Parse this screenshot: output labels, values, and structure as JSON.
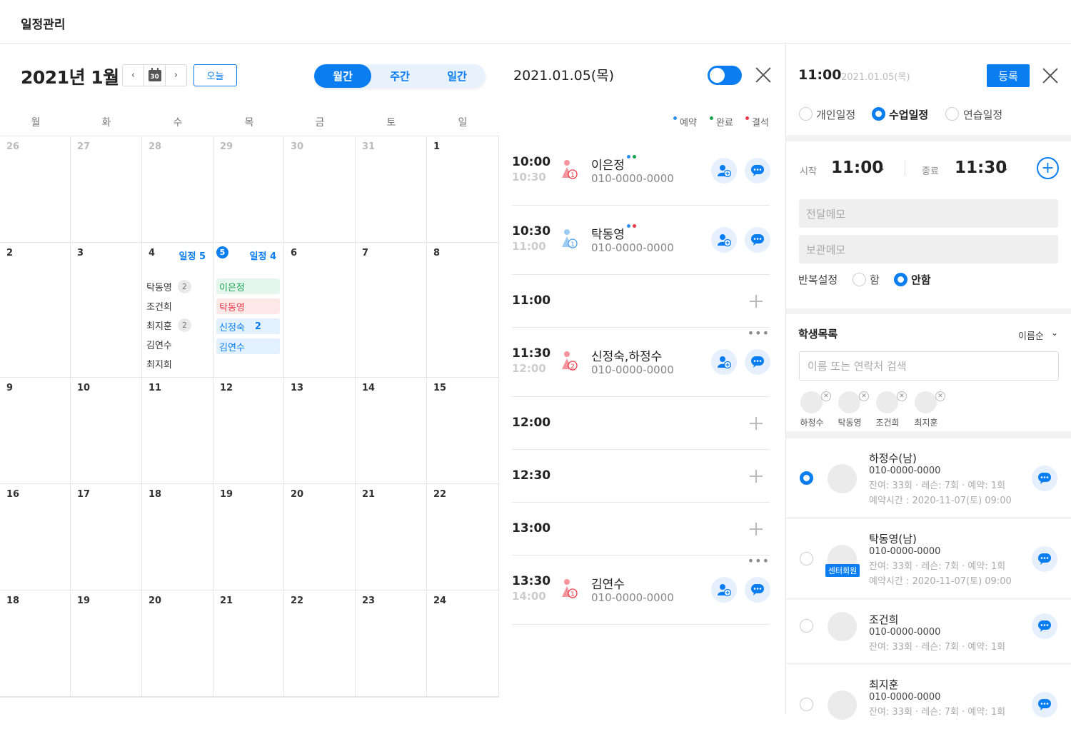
{
  "app": {
    "title": "일정관리"
  },
  "calendar": {
    "month_title": "2021년 1월",
    "calendar_icon_day": "30",
    "today_label": "오늘",
    "view_tabs": [
      "월간",
      "주간",
      "일간"
    ],
    "active_view": "월간",
    "weekdays": [
      "월",
      "화",
      "수",
      "목",
      "금",
      "토",
      "일"
    ],
    "weeks": [
      [
        "26",
        "27",
        "28",
        "29",
        "30",
        "31",
        "1"
      ],
      [
        "2",
        "3",
        "4",
        "5",
        "6",
        "7",
        "8"
      ],
      [
        "9",
        "10",
        "11",
        "12",
        "13",
        "14",
        "15"
      ],
      [
        "16",
        "17",
        "18",
        "19",
        "20",
        "21",
        "22"
      ],
      [
        "18",
        "19",
        "20",
        "21",
        "22",
        "23",
        "24"
      ]
    ],
    "day4": {
      "schedule_count": "일정 5",
      "names": [
        {
          "name": "탁동영",
          "count": "2"
        },
        {
          "name": "조건희",
          "count": ""
        },
        {
          "name": "최지훈",
          "count": "2"
        },
        {
          "name": "김연수",
          "count": ""
        },
        {
          "name": "최지희",
          "count": ""
        }
      ]
    },
    "day5": {
      "schedule_count": "일정 4",
      "chips": [
        {
          "name": "이은정",
          "status": "green",
          "count": ""
        },
        {
          "name": "탁동영",
          "status": "red",
          "count": ""
        },
        {
          "name": "신정숙",
          "status": "blue",
          "count": "2"
        },
        {
          "name": "김연수",
          "status": "blue",
          "count": ""
        }
      ]
    }
  },
  "day_panel": {
    "date": "2021.01.05(목)",
    "legend": [
      {
        "label": "예약",
        "color": "#2f8ff0"
      },
      {
        "label": "완료",
        "color": "#1aa352"
      },
      {
        "label": "결석",
        "color": "#ef3b4a"
      }
    ],
    "slots": [
      {
        "start": "10:00",
        "end": "10:30",
        "name": "이은정",
        "tel": "010-0000-0000",
        "people": "1",
        "dots": [
          "#2f8ff0",
          "#1aa352"
        ]
      },
      {
        "start": "10:30",
        "end": "11:00",
        "name": "탁동영",
        "tel": "010-0000-0000",
        "people": "1",
        "dots": [
          "#2f8ff0",
          "#ef3b4a"
        ]
      },
      {
        "start": "11:00",
        "end": "",
        "name": "",
        "tel": ""
      },
      {
        "start": "11:30",
        "end": "12:00",
        "name": "신정숙,하정수",
        "tel": "010-0000-0000",
        "people": "2",
        "dots": []
      },
      {
        "start": "12:00",
        "end": "",
        "name": "",
        "tel": ""
      },
      {
        "start": "12:30",
        "end": "",
        "name": "",
        "tel": ""
      },
      {
        "start": "13:00",
        "end": "",
        "name": "",
        "tel": ""
      },
      {
        "start": "13:30",
        "end": "14:00",
        "name": "김연수",
        "tel": "010-0000-0000",
        "people": "1",
        "dots": []
      }
    ]
  },
  "editor": {
    "time": "11:00",
    "date": "2021.01.05(목)",
    "register_label": "등록",
    "types": [
      "개인일정",
      "수업일정",
      "연습일정"
    ],
    "selected_type": "수업일정",
    "start_label": "시작",
    "start_value": "11:00",
    "end_label": "종료",
    "end_value": "11:30",
    "memo_placeholder": "전달메모",
    "keep_memo_placeholder": "보관메모",
    "repeat_label": "반복설정",
    "repeat_options": [
      "함",
      "안함"
    ],
    "repeat_selected": "안함"
  },
  "students": {
    "title": "학생목록",
    "sort_label": "이름순",
    "search_placeholder": "이름 또는 연락처 검색",
    "selected": [
      "하정수",
      "탁동영",
      "조건희",
      "최지훈"
    ],
    "list": [
      {
        "name": "하정수(남)",
        "tel": "010-0000-0000",
        "detail": "잔여: 33회  ·  레슨: 7회  ·  예약: 1회",
        "reserve": "예약시간 : 2020-11-07(토) 09:00",
        "checked": true,
        "badge": ""
      },
      {
        "name": "탁동영(남)",
        "tel": "010-0000-0000",
        "detail": "잔여: 33회  ·  레슨: 7회  ·  예약: 1회",
        "reserve": "예약시간 : 2020-11-07(토) 09:00",
        "checked": false,
        "badge": "센터회원"
      },
      {
        "name": "조건희",
        "tel": "010-0000-0000",
        "detail": "잔여: 33회  ·  레슨: 7회  ·  예약: 1회",
        "reserve": "",
        "checked": false,
        "badge": ""
      },
      {
        "name": "최지훈",
        "tel": "010-0000-0000",
        "detail": "잔여: 33회  ·  레슨: 7회  ·  예약: 1회",
        "reserve": "",
        "checked": false,
        "badge": ""
      }
    ]
  }
}
